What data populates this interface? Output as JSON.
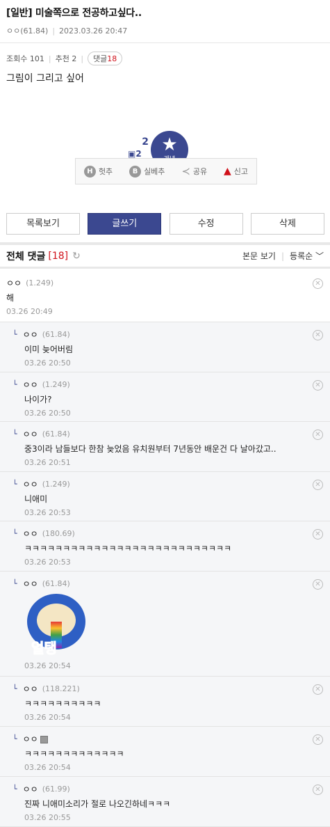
{
  "post": {
    "title": "[일반] 미술쪽으로 전공하고싶다..",
    "author": "ㅇㅇ(61.84)",
    "date": "2023.03.26 20:47",
    "views_label": "조회수 101",
    "reco_label": "추천 2",
    "comments_pill_label": "댓글",
    "comments_pill_count": "18",
    "body": "그림이 그리고 싶어"
  },
  "recommend": {
    "count": "2",
    "fixed_count": "2",
    "star_label": "개념"
  },
  "actions": {
    "heotchu": "헛추",
    "silbechu": "실베추",
    "share": "공유",
    "report": "신고",
    "h_icon": "H",
    "b_icon": "B"
  },
  "buttons": {
    "list": "목록보기",
    "write": "글쓰기",
    "edit": "수정",
    "delete": "삭제"
  },
  "comments_header": {
    "title": "전체 댓글",
    "count": "[18]",
    "view_body": "본문 보기",
    "sort": "등록순"
  },
  "comments": [
    {
      "name": "ㅇㅇ",
      "ip": "(1.249)",
      "text": "해",
      "date": "03.26 20:49"
    },
    {
      "name": "ㅇㅇ",
      "ip": "(61.84)",
      "text": "이미 늦어버림",
      "date": "03.26 20:50"
    },
    {
      "name": "ㅇㅇ",
      "ip": "(1.249)",
      "text": "나이가?",
      "date": "03.26 20:50"
    },
    {
      "name": "ㅇㅇ",
      "ip": "(61.84)",
      "text": "중3이라 남들보다 한참 늦었음 유치원부터 7년동안 배운건 다 날아갔고..",
      "date": "03.26 20:51"
    },
    {
      "name": "ㅇㅇ",
      "ip": "(1.249)",
      "text": "니애미",
      "date": "03.26 20:53"
    },
    {
      "name": "ㅇㅇ",
      "ip": "(180.69)",
      "text": "ㅋㅋㅋㅋㅋㅋㅋㅋㅋㅋㅋㅋㅋㅋㅋㅋㅋㅋㅋㅋㅋㅋㅋㅋㅋㅋㅋ",
      "date": "03.26 20:53"
    },
    {
      "name": "ㅇㅇ",
      "ip": "(61.84)",
      "dccon": "얼탱",
      "date": "03.26 20:54"
    },
    {
      "name": "ㅇㅇ",
      "ip": "(118.221)",
      "text": "ㅋㅋㅋㅋㅋㅋㅋㅋㅋㅋ",
      "date": "03.26 20:54"
    },
    {
      "name": "ㅇㅇ",
      "ip": "",
      "text": "ㅋㅋㅋㅋㅋㅋㅋㅋㅋㅋㅋㅋㅋ",
      "date": "03.26 20:54"
    },
    {
      "name": "ㅇㅇ",
      "ip": "(61.99)",
      "text": "진짜 니애미소리가 절로 나오긴하네ㅋㅋㅋ",
      "date": "03.26 20:55"
    }
  ]
}
